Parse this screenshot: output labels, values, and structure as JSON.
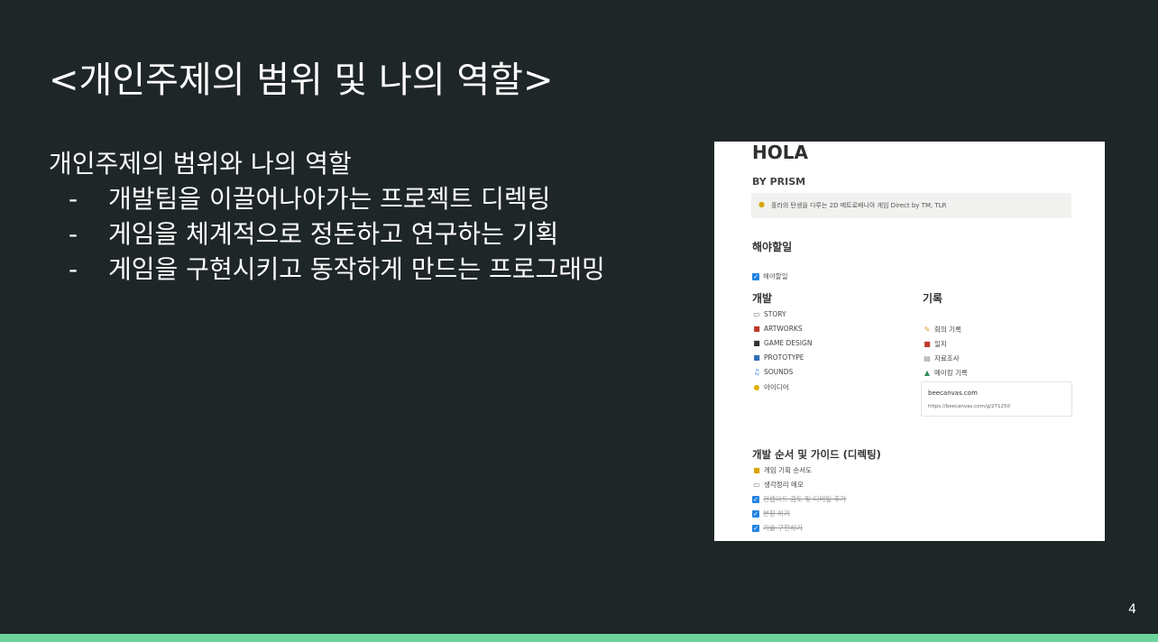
{
  "slide": {
    "title": "<개인주제의 범위 및 나의 역할>",
    "subtitle": "개인주제의 범위와 나의 역할",
    "bullets": [
      "개발팀을 이끌어나아가는 프로젝트 디렉팅",
      "게임을 체계적으로 정돈하고 연구하는 기획",
      "게임을 구현시키고 동작하게 만드는 프로그래밍"
    ],
    "page_number": "4",
    "accent_color": "#6cd39a",
    "background_color": "#1f2628"
  },
  "notion": {
    "title": "HOLA",
    "subtitle": "BY PRISM",
    "callout": {
      "icon": "lightbulb-icon",
      "text": "홀라의 탄생을 다루는 2D 메트로배니아 게임 Direct by TM, TLR"
    },
    "todo_heading": "해야할일",
    "todo_item": "해야할일",
    "dev": {
      "heading": "개발",
      "items": [
        {
          "icon": "page-icon",
          "label": "STORY"
        },
        {
          "icon": "books-icon",
          "label": "ARTWORKS"
        },
        {
          "icon": "gamepad-icon",
          "label": "GAME DESIGN"
        },
        {
          "icon": "monitor-icon",
          "label": "PROTOTYPE"
        },
        {
          "icon": "music-icon",
          "label": "SOUNDS"
        },
        {
          "icon": "lightbulb-icon",
          "label": "아이디어"
        }
      ]
    },
    "records": {
      "heading": "기록",
      "items": [
        {
          "icon": "pencil-icon",
          "label": "회의 기록"
        },
        {
          "icon": "books-icon",
          "label": "일지"
        },
        {
          "icon": "archive-icon",
          "label": "자료조사"
        },
        {
          "icon": "chart-icon",
          "label": "메이킹 기록"
        }
      ]
    },
    "bookmark": {
      "title": "beecanvas.com",
      "url": "https://beecanvas.com/g/271250"
    },
    "guide": {
      "heading": "개발 순서 및 가이드 (디렉팅)",
      "items": [
        {
          "icon": "notebook-icon",
          "label": "게임 기획 순서도"
        },
        {
          "icon": "page-icon",
          "label": "생각정리 메모"
        }
      ],
      "done_items": [
        "컨셉아트 검토 및 디테일 추가",
        "분장 하기",
        "기술 구현하기"
      ]
    }
  }
}
